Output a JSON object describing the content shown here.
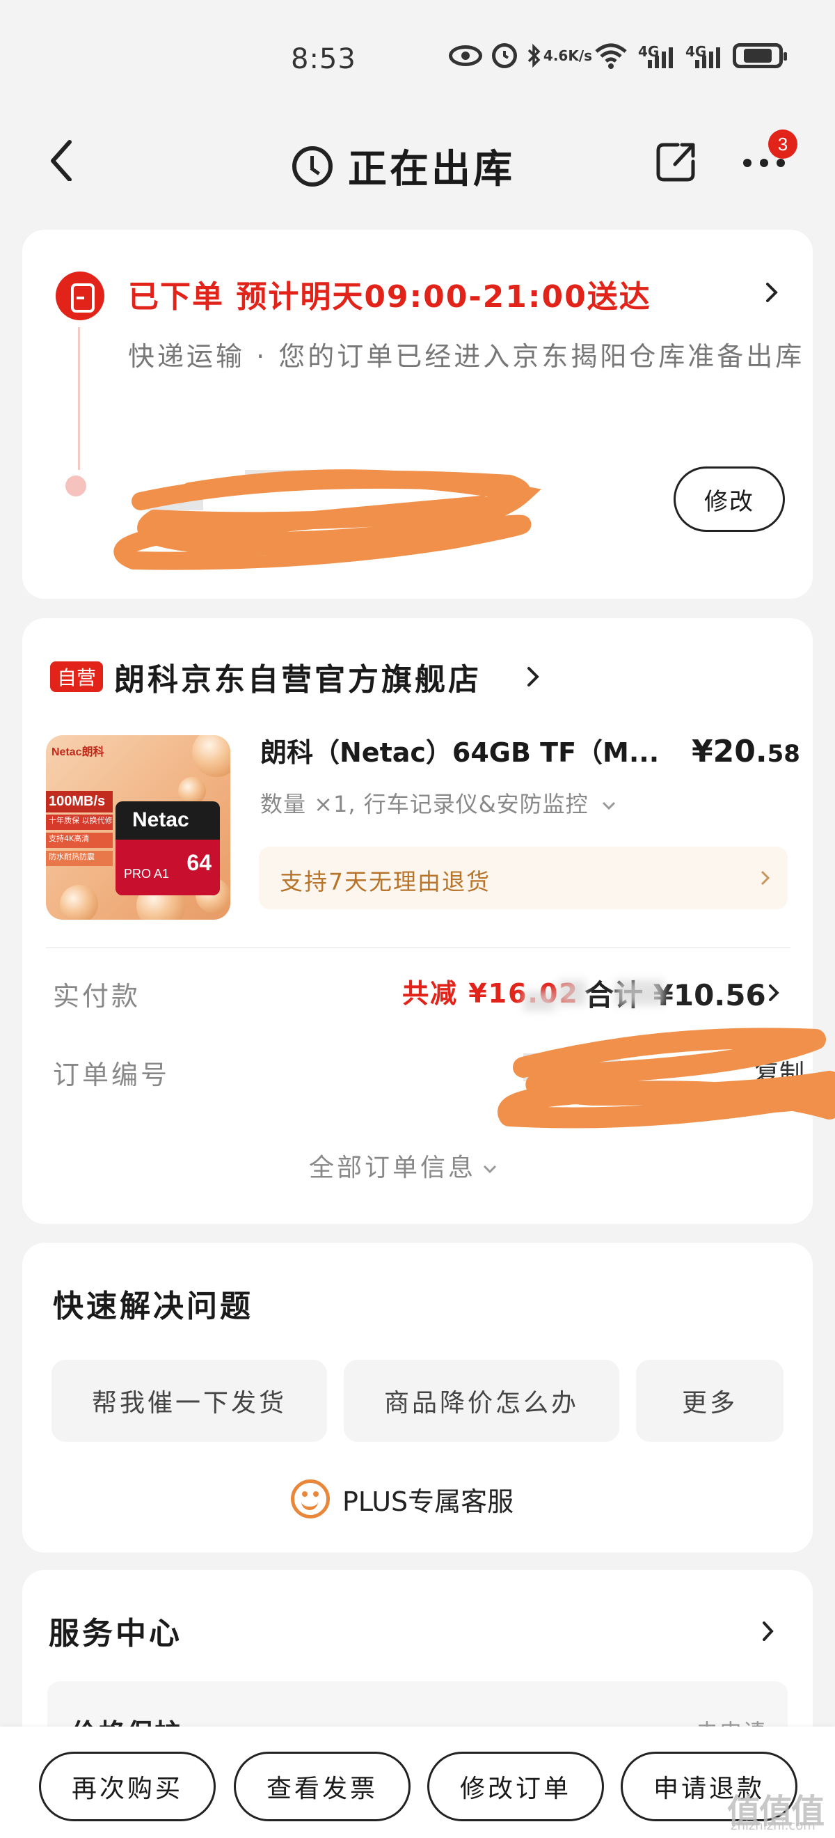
{
  "status_bar": {
    "time": "8:53",
    "speed_value": "4.6",
    "speed_unit": "K/s",
    "net1": "4G",
    "net2": "4G",
    "icons": [
      "eye-icon",
      "alarm-icon",
      "bluetooth-icon",
      "wifi-icon",
      "signal-icon",
      "battery-icon"
    ]
  },
  "header": {
    "title": "正在出库",
    "badge_count": "3"
  },
  "status_card": {
    "headline": "已下单 预计明天09:00-21:00送达",
    "detail": "快递运输 · 您的订单已经进入京东揭阳仓库准备出库",
    "modify_label": "修改"
  },
  "order_card": {
    "self_tag": "自营",
    "store_name": "朗科京东自营官方旗舰店",
    "product_image": {
      "brand": "Netac朗科",
      "speed": "100MB/s",
      "line1": "十年质保 以换代修",
      "line2": "支持4K高清",
      "line3": "防水耐热防震",
      "card_logo": "Netac",
      "card_pro": "PRO A1",
      "card_capacity": "64"
    },
    "product_name": "朗科（Netac）64GB TF（M...",
    "price_yuan": "¥20.",
    "price_cents": "58",
    "spec": "数量 ×1, 行车记录仪&安防监控",
    "return_policy": "支持7天无理由退货",
    "paid_label": "实付款",
    "discount_text": "共减 ¥16.02",
    "total_text": "合计 ¥10.56",
    "order_no_label": "订单编号",
    "copy_label": "复制",
    "all_info_label": "全部订单信息"
  },
  "quick_card": {
    "title": "快速解决问题",
    "buttons": [
      "帮我催一下发货",
      "商品降价怎么办",
      "更多"
    ],
    "plus_service": "PLUS专属客服"
  },
  "service_card": {
    "title": "服务中心",
    "row_label": "价格保护",
    "row_action": "去申请"
  },
  "bottom_bar": {
    "buttons": [
      "再次购买",
      "查看发票",
      "修改订单",
      "申请退款"
    ]
  },
  "watermark": {
    "text": "值值值",
    "url": "zhizhizhi.com"
  },
  "colors": {
    "brand_red": "#e2231a",
    "return_text": "#b8742a",
    "scribble_orange": "#f0904a"
  }
}
